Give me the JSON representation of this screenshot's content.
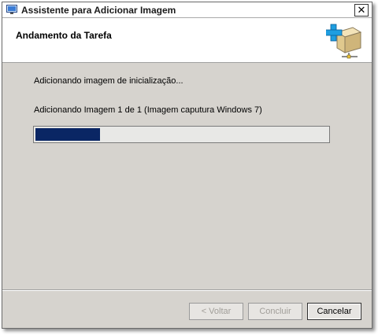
{
  "window": {
    "title": "Assistente para Adicionar Imagem",
    "close_glyph": "✕"
  },
  "header": {
    "title": "Andamento da Tarefa",
    "icon": "wizard-image-add-icon"
  },
  "main": {
    "status": "Adicionando imagem de inicialização...",
    "detail": "Adicionando Imagem 1 de 1 (Imagem caputura Windows 7)",
    "progress_fraction": 0.22
  },
  "buttons": {
    "back": "< Voltar",
    "finish": "Concluir",
    "cancel": "Cancelar"
  },
  "colors": {
    "progress_fill": "#0a2664",
    "accent_plus": "#1e9ee0"
  }
}
